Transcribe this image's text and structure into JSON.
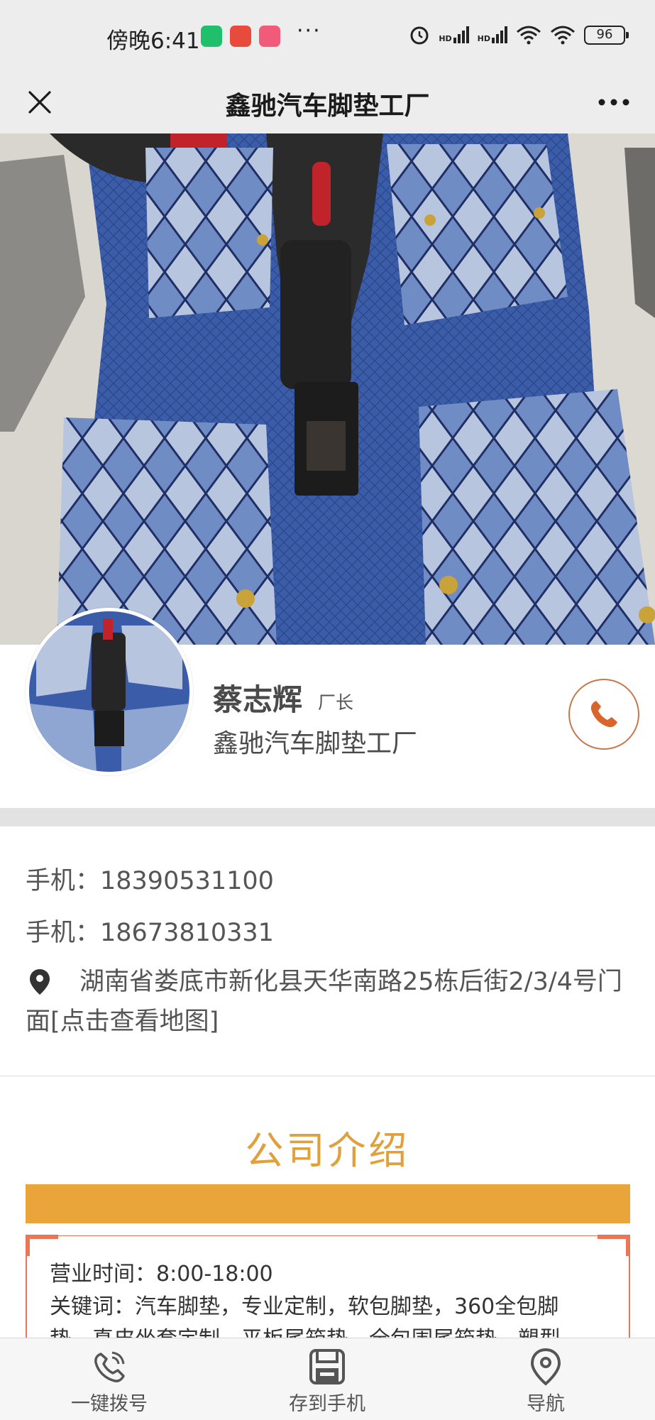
{
  "status_bar": {
    "time": "傍晚6:41",
    "dots": "···",
    "hd1": "HD",
    "hd2": "HD",
    "battery": "96"
  },
  "title_bar": {
    "title": "鑫驰汽车脚垫工厂",
    "close_icon": "close-icon",
    "more_icon": "more-icon"
  },
  "profile": {
    "name": "蔡志辉",
    "role": "厂长",
    "company": "鑫驰汽车脚垫工厂"
  },
  "contact": {
    "phone1": "手机：18390531100",
    "phone2": "手机：18673810331",
    "address": "湖南省娄底市新化县天华南路25栋后街2/3/4号门面[点击查看地图]"
  },
  "intro": {
    "title": "公司介绍",
    "hours": "营业时间：8:00-18:00",
    "keywords1": "关键词：汽车脚垫，专业定制，软包脚垫，360全包脚",
    "keywords2": "垫，真皮坐套定制，平板尾箱垫，全包围尾箱垫，塑型"
  },
  "bottom_nav": [
    {
      "label": "一键拨号",
      "icon": "phone-call-icon"
    },
    {
      "label": "存到手机",
      "icon": "save-icon"
    },
    {
      "label": "导航",
      "icon": "location-pin-icon"
    }
  ],
  "colors": {
    "accent_orange": "#eaa53a",
    "call_border": "#c9764a",
    "frame_red": "#e8775a",
    "mat_blue": "#3a5a99"
  }
}
